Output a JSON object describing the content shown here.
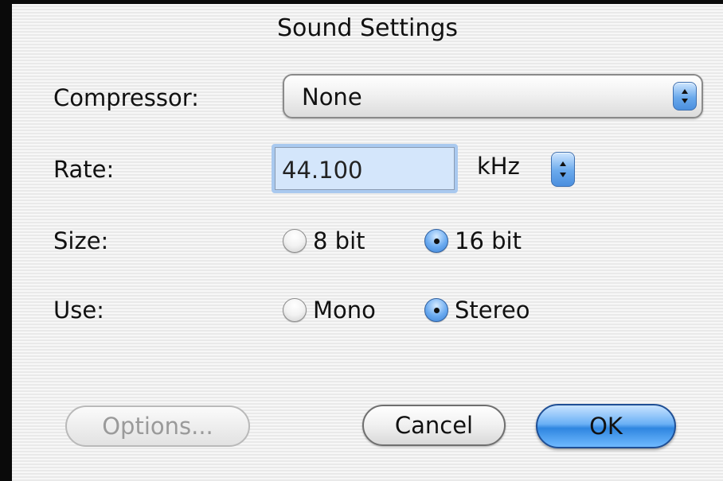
{
  "dialog": {
    "title": "Sound Settings"
  },
  "compressor": {
    "label": "Compressor:",
    "value": "None",
    "icon": "up-down-arrows-icon"
  },
  "rate": {
    "label": "Rate:",
    "value": "44.100",
    "unit": "kHz",
    "icon": "up-down-arrows-icon"
  },
  "size": {
    "label": "Size:",
    "options": [
      {
        "label": "8 bit",
        "selected": false
      },
      {
        "label": "16 bit",
        "selected": true
      }
    ]
  },
  "use": {
    "label": "Use:",
    "options": [
      {
        "label": "Mono",
        "selected": false
      },
      {
        "label": "Stereo",
        "selected": true
      }
    ]
  },
  "buttons": {
    "options": "Options...",
    "options_enabled": false,
    "cancel": "Cancel",
    "ok": "OK",
    "default": "ok"
  },
  "colors": {
    "accent": "#4b8fde",
    "selection": "#a9c9ef"
  }
}
